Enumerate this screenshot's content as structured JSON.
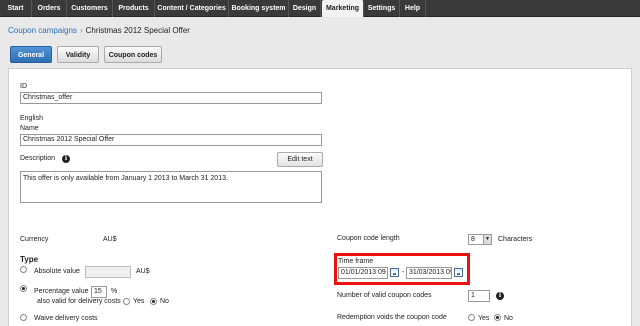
{
  "nav": [
    "Start",
    "Orders",
    "Customers",
    "Products",
    "Content / Categories",
    "Booking system",
    "Design",
    "Marketing",
    "Settings",
    "Help"
  ],
  "nav_active": "Marketing",
  "breadcrumb": {
    "parent": "Coupon campaigns",
    "separator": "›",
    "current": "Christmas 2012 Special Offer"
  },
  "tabs": [
    "General",
    "Validity",
    "Coupon codes"
  ],
  "form": {
    "id_label": "ID",
    "id_value": "Christmas_offer",
    "language": "English",
    "name_label": "Name",
    "name_value": "Christmas 2012 Special Offer",
    "description_label": "Description",
    "info_glyph": "i",
    "edit_text_button": "Edit text",
    "description_value": "This offer is only available from January 1 2013 to March 31 2013.",
    "currency_label": "Currency",
    "currency_value": "AU$",
    "type_label": "Type",
    "absolute_label": "Absolute value",
    "absolute_unit": "AU$",
    "percentage_label": "Percentage value",
    "percentage_value": "15",
    "percentage_unit": "%",
    "delivery_valid_label": "also valid for delivery costs",
    "yes": "Yes",
    "no": "No",
    "waive_label": "Waive delivery costs",
    "code_length_label": "Coupon code length",
    "code_length_value": "8",
    "characters_label": "Characters",
    "timeframe_label": "Time frame",
    "timeframe_start": "01/01/2013 09",
    "timeframe_dash": "-",
    "timeframe_end": "31/03/2013 09",
    "valid_codes_label": "Number of valid coupon codes",
    "valid_codes_value": "1",
    "redemption_label": "Redemption voids the coupon code",
    "selected_type": "percentage",
    "delivery_valid_selected": "No",
    "redemption_selected": "No"
  },
  "colors": {
    "nav_bg": "#3a3a3a",
    "tab_active": "#2d6fb4",
    "link": "#2a6db5",
    "highlight": "#e11111"
  },
  "icons": [
    "info-icon",
    "calendar-icon",
    "dropdown-arrow-icon"
  ]
}
